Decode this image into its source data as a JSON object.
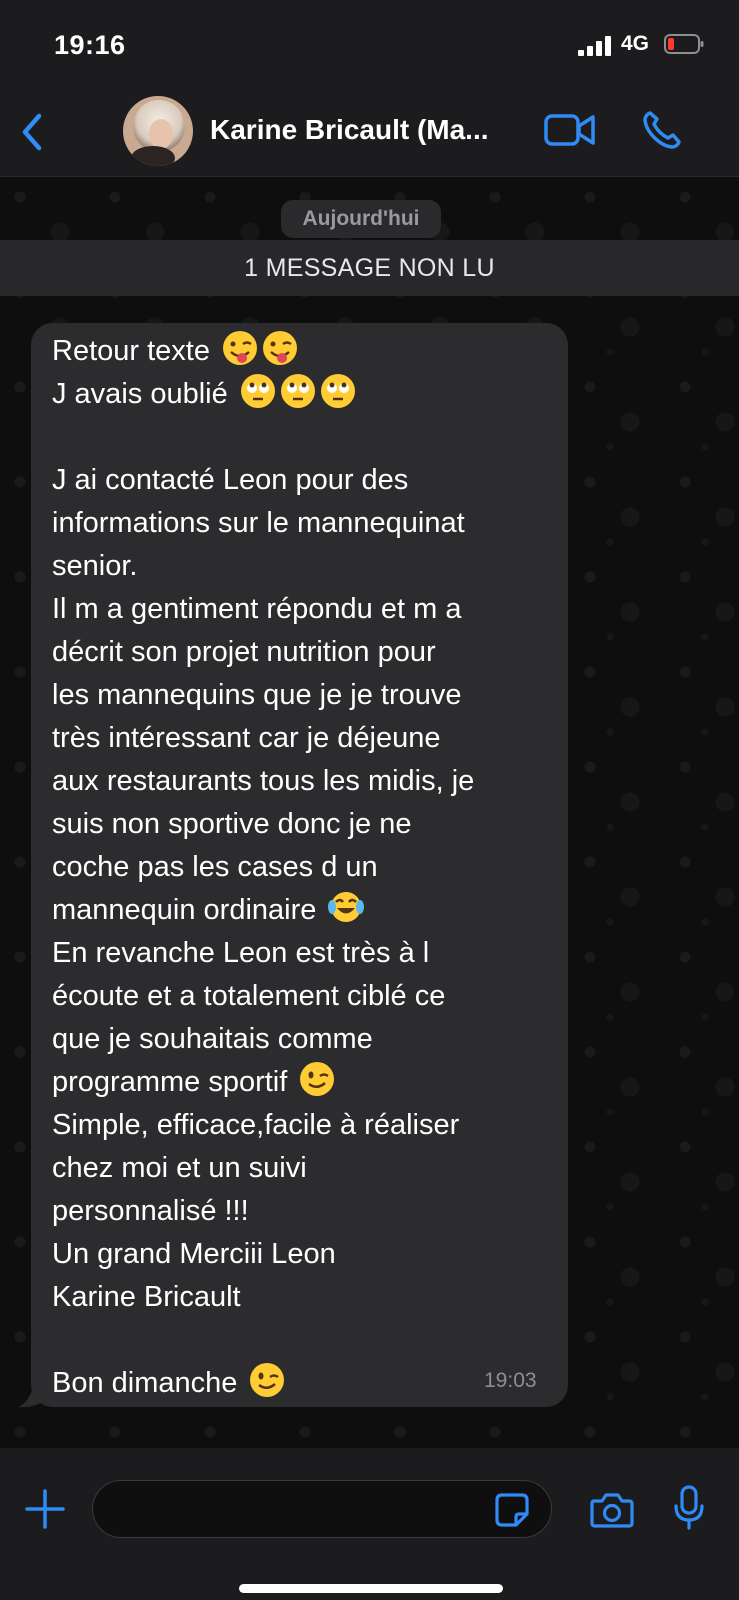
{
  "status_bar": {
    "time": "19:16",
    "network": "4G"
  },
  "header": {
    "contact_name": "Karine Bricault (Ma...",
    "accent_color": "#2f8bf5"
  },
  "chat": {
    "date_chip": "Aujourd'hui",
    "unread_banner": "1 MESSAGE NON LU",
    "message": {
      "lines": [
        "Retour texte",
        "J avais oublié",
        "",
        "J ai contacté Leon pour des",
        "informations sur le mannequinat",
        "senior.",
        "Il m a gentiment répondu et m a",
        "décrit son projet nutrition pour",
        "les mannequins que je je trouve",
        "très intéressant car je déjeune",
        "aux restaurants tous les midis, je",
        "suis non sportive donc je ne",
        "coche pas les cases d un",
        "mannequin ordinaire",
        "En revanche Leon est très à l",
        "écoute et a totalement ciblé ce",
        "que je souhaitais comme",
        "programme sportif",
        "Simple, efficace,facile à réaliser",
        "chez moi et un suivi",
        "personnalisé !!!",
        "Un grand Merciii Leon",
        "Karine Bricault",
        "",
        "Bon dimanche"
      ],
      "time": "19:03",
      "emojis": {
        "line_0": [
          "winking-face-with-tongue",
          "winking-face-with-tongue"
        ],
        "line_1": [
          "face-with-rolling-eyes",
          "face-with-rolling-eyes",
          "face-with-rolling-eyes"
        ],
        "line_13": [
          "face-with-tears-of-joy"
        ],
        "line_17": [
          "winking-face"
        ],
        "line_24": [
          "winking-face"
        ]
      }
    }
  },
  "composer": {
    "icons": [
      "plus-icon",
      "sticker-icon",
      "camera-icon",
      "microphone-icon"
    ]
  }
}
